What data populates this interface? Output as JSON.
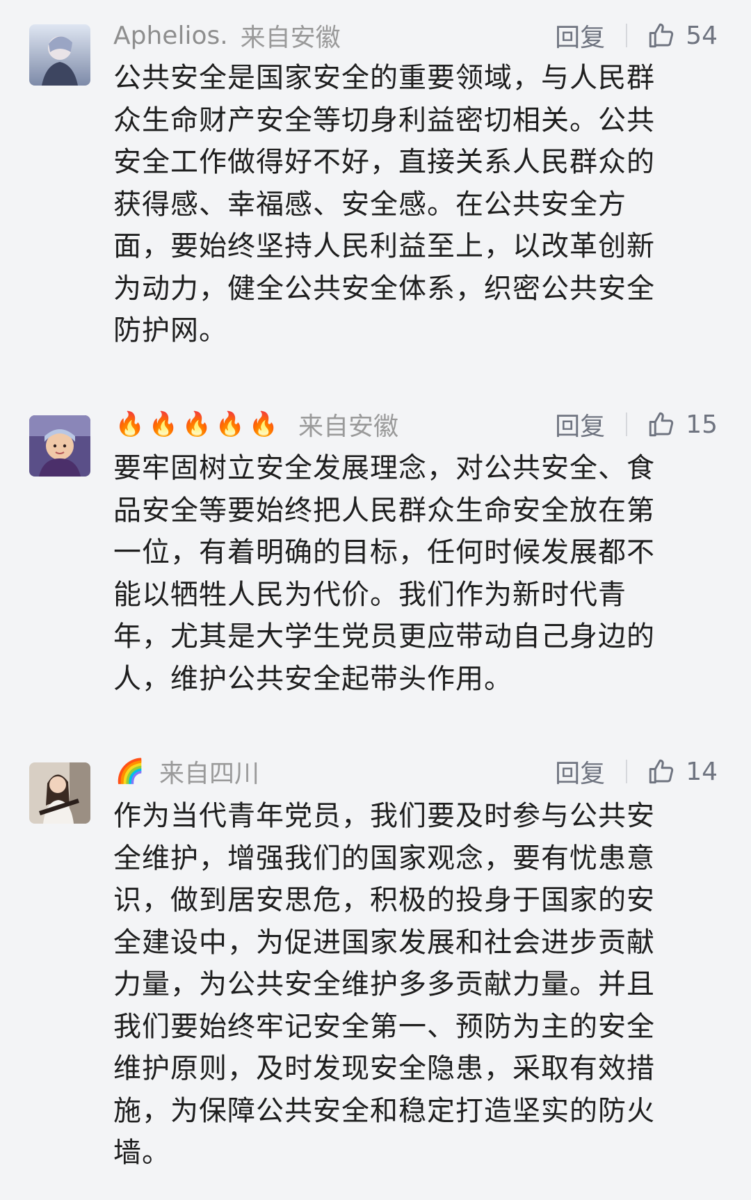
{
  "comments": [
    {
      "username": "Aphelios.",
      "location": "来自安徽",
      "reply_label": "回复",
      "like_count": "54",
      "lines": [
        "公共安全是国家安全的重要领域，与人民群",
        "众生命财产安全等切身利益密切相关。公共",
        "安全工作做得好不好，直接关系人民群众的",
        "获得感、幸福感、安全感。在公共安全方",
        "面，要始终坚持人民利益至上，以改革创新",
        "为动力，健全公共安全体系，织密公共安全",
        "防护网。"
      ]
    },
    {
      "username_emoji": "🔥🔥🔥🔥🔥",
      "location": "来自安徽",
      "reply_label": "回复",
      "like_count": "15",
      "lines": [
        "要牢固树立安全发展理念，对公共安全、食",
        "品安全等要始终把人民群众生命安全放在第",
        "一位，有着明确的目标，任何时候发展都不",
        "能以牺牲人民为代价。我们作为新时代青",
        "年，尤其是大学生党员更应带动自己身边的",
        "人，维护公共安全起带头作用。"
      ]
    },
    {
      "username_emoji": "🌈",
      "location": "来自四川",
      "reply_label": "回复",
      "like_count": "14",
      "lines": [
        "作为当代青年党员，我们要及时参与公共安",
        "全维护，增强我们的国家观念，要有忧患意",
        "识，做到居安思危，积极的投身于国家的安",
        "全建设中，为促进国家发展和社会进步贡献",
        "力量，为公共安全维护多多贡献力量。并且",
        "我们要始终牢记安全第一、预防为主的安全",
        "维护原则，及时发现安全隐患，采取有效措",
        "施，为保障公共安全和稳定打造坚实的防火",
        "墙。"
      ]
    }
  ],
  "icons": {
    "like": "thumbs-up-outline-icon",
    "fire": "fire-emoji-icon",
    "rainbow": "rainbow-emoji-icon"
  },
  "colors": {
    "background": "#f3f4f6",
    "meta_text": "#9a9a9a",
    "action_text": "#6f7480",
    "body_text": "#1e1e1e"
  }
}
